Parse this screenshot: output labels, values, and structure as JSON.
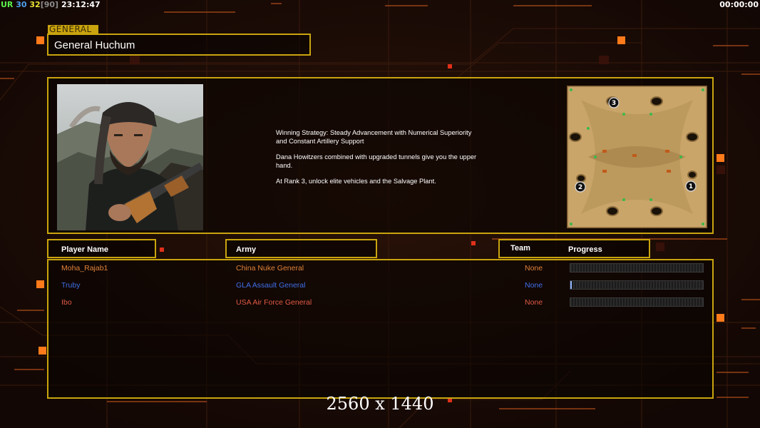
{
  "hud": {
    "left": [
      {
        "text": "UR",
        "color": "u"
      },
      {
        "text": "30",
        "color": "r"
      },
      {
        "text": "32",
        "color": "y"
      },
      {
        "text": "[90]",
        "color": "gr"
      },
      {
        "text": "23:12:47",
        "color": "w"
      }
    ],
    "timer": "00:00:00"
  },
  "general": {
    "section_label": "GENERAL",
    "name": "General Huchum"
  },
  "strategy": {
    "paragraphs": [
      "Winning Strategy: Steady Advancement with Numerical Superiority\n and Constant Artillery Support",
      "Dana Howitzers combined with upgraded tunnels give you the upper\n hand.",
      "At Rank 3, unlock elite vehicles and the Salvage Plant."
    ]
  },
  "map": {
    "start_markers": [
      "3",
      "2",
      "1"
    ]
  },
  "headers": {
    "player_name": "Player Name",
    "army": "Army",
    "team": "Team",
    "progress": "Progress"
  },
  "players": [
    {
      "name": "Moha_Rajab1",
      "army": "China Nuke General",
      "team": "None",
      "progress": 0,
      "color": "#e0823a"
    },
    {
      "name": "Truby",
      "army": "GLA Assault General",
      "team": "None",
      "progress": 0.01,
      "color": "#3f6fe8"
    },
    {
      "name": "Ibo",
      "army": "USA Air Force General",
      "team": "None",
      "progress": 0,
      "color": "#e05a44"
    }
  ],
  "overlay": {
    "resolution": "2560 x 1440"
  },
  "colors": {
    "frame": "#c9a40e",
    "background": "#160a06",
    "accent_orange": "#ff7a1a"
  }
}
